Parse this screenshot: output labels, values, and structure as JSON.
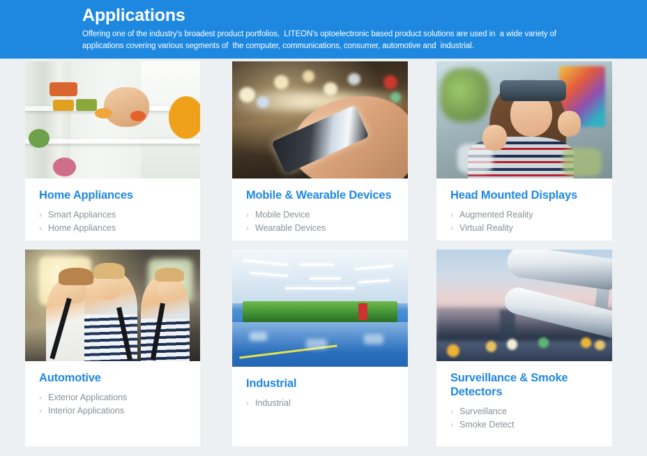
{
  "hero": {
    "title": "Applications",
    "subtitle": "Offering one of the industry's broadest product portfolios,  LITEON's optoelectronic based product solutions are used in  a wide variety of applications covering various segments of  the computer, communications, consumer, automotive and  industrial."
  },
  "colors": {
    "hero_background": "#1e88e1",
    "card_title": "#1e88e1",
    "page_background": "#edf0f2",
    "card_background": "#ffffff",
    "link_text": "#8a8f94",
    "chevron": "#b9c0c6"
  },
  "chevron_glyph": "›",
  "cards": [
    {
      "title": "Home Appliances",
      "image_name": "home-appliances-photo",
      "image_alt": "Couple laughing in front of an open refrigerator filled with fruit and vegetables",
      "links": [
        "Smart Appliances",
        "Home Appliances"
      ]
    },
    {
      "title": "Mobile & Wearable Devices",
      "image_name": "mobile-wearable-photo",
      "image_alt": "Hand holding a smartphone at night with blurred city bokeh lights",
      "links": [
        "Mobile Device",
        "Wearable Devices"
      ]
    },
    {
      "title": "Head Mounted Displays",
      "image_name": "head-mounted-displays-photo",
      "image_alt": "Smiling woman wearing a virtual reality headset and reaching forward",
      "links": [
        "Augmented Reality",
        "Virtual Reality"
      ]
    },
    {
      "title": "Automotive",
      "image_name": "automotive-photo",
      "image_alt": "Three children laughing in the back seat of a car in sunlight",
      "links": [
        "Exterior Applications",
        "Interior Applications"
      ]
    },
    {
      "title": "Industrial",
      "image_name": "industrial-photo",
      "image_alt": "Clean factory floor with green production machines and glossy blue epoxy floor",
      "links": [
        "Industrial"
      ]
    },
    {
      "title": "Surveillance & Smoke Detectors",
      "image_name": "surveillance-smoke-detectors-photo",
      "image_alt": "Two white CCTV security cameras against a dusk city skyline",
      "links": [
        "Surveillance",
        "Smoke Detect"
      ]
    }
  ]
}
